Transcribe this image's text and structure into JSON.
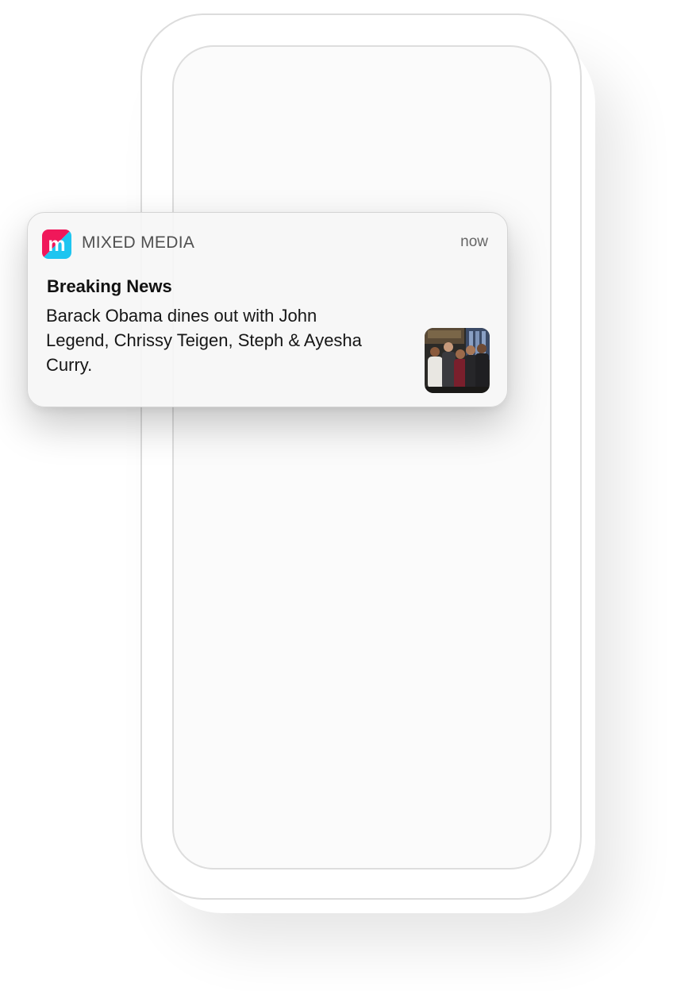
{
  "notification": {
    "app_name": "MIXED MEDIA",
    "time": "now",
    "title": "Breaking News",
    "body": "Barack Obama dines out with John Legend, Chrissy Teigen, Steph & Ayesha Curry.",
    "app_icon": {
      "icon": "mixed-media-logo-icon",
      "letter": "m",
      "colors": [
        "#f0185a",
        "#1ec5f0"
      ]
    },
    "thumbnail": "group-photo"
  }
}
